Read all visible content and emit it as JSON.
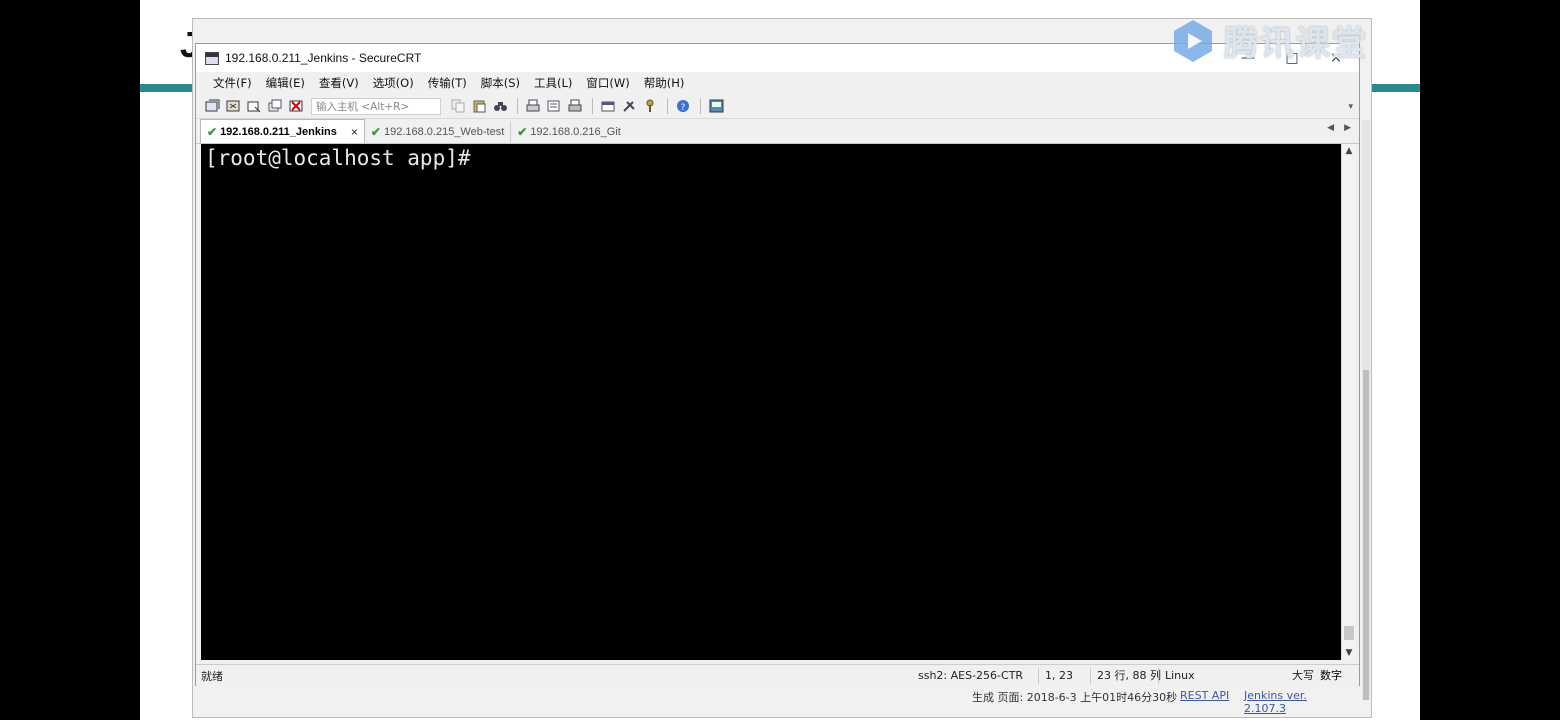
{
  "watermark": {
    "text": "腾讯课堂"
  },
  "background": {
    "glyph": "J"
  },
  "window": {
    "title": "192.168.0.211_Jenkins - SecureCRT",
    "controls": {
      "minimize": "—",
      "maximize": "□",
      "close": "×"
    }
  },
  "menu": [
    "文件(F)",
    "编辑(E)",
    "查看(V)",
    "选项(O)",
    "传输(T)",
    "脚本(S)",
    "工具(L)",
    "窗口(W)",
    "帮助(H)"
  ],
  "toolbar": {
    "quick_connect_placeholder": "输入主机 <Alt+R>",
    "icons": [
      "connect-icon",
      "quick-connect-icon",
      "connect-tab-icon",
      "clone-session-icon",
      "disconnect-icon",
      "copy-icon",
      "paste-icon",
      "find-icon",
      "print-icon",
      "print-setup-icon",
      "print-screen-icon",
      "session-options-icon",
      "global-options-icon",
      "keymap-icon",
      "help-icon",
      "sftp-icon"
    ]
  },
  "tabs": [
    {
      "label": "192.168.0.211_Jenkins",
      "active": true,
      "close": "×"
    },
    {
      "label": "192.168.0.215_Web-test",
      "active": false
    },
    {
      "label": "192.168.0.216_Git",
      "active": false
    }
  ],
  "terminal": {
    "prompt": "[root@localhost app]#"
  },
  "status": {
    "ready": "就绪",
    "protocol": "ssh2: AES-256-CTR",
    "cursor": "1, 23",
    "size": "23 行, 88 列",
    "os": "Linux",
    "caps": "大写",
    "num": "数字"
  },
  "footer": {
    "generated": "生成 页面: 2018-6-3 上午01时46分30秒",
    "rest_api": "REST API",
    "version": "Jenkins ver. 2.107.3"
  }
}
